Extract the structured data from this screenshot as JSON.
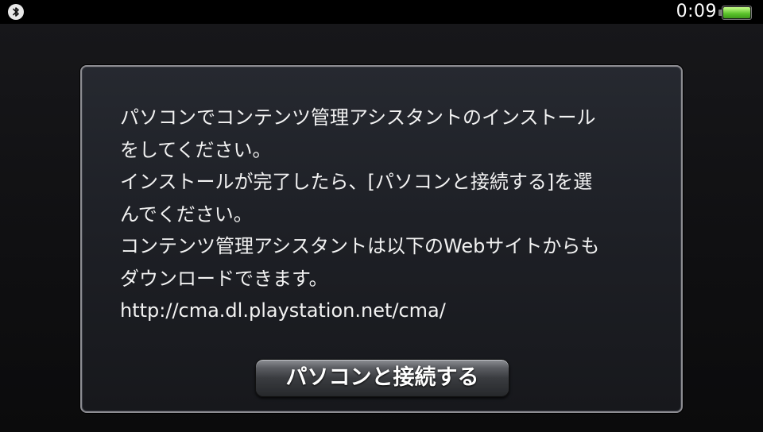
{
  "status_bar": {
    "bluetooth_icon": "bluetooth-icon",
    "time": "0:09",
    "battery_icon": "battery-icon",
    "battery_level": 1.0,
    "battery_color": "#59c12a"
  },
  "dialog": {
    "message_lines": [
      "パソコンでコンテンツ管理アシスタントのインストール",
      "をしてください。",
      "インストールが完了したら、[パソコンと接続する]を選",
      "んでください。",
      "コンテンツ管理アシスタントは以下のWebサイトからも",
      "ダウンロードできます。",
      "http://cma.dl.playstation.net/cma/"
    ],
    "button_label": "パソコンと接続する"
  }
}
